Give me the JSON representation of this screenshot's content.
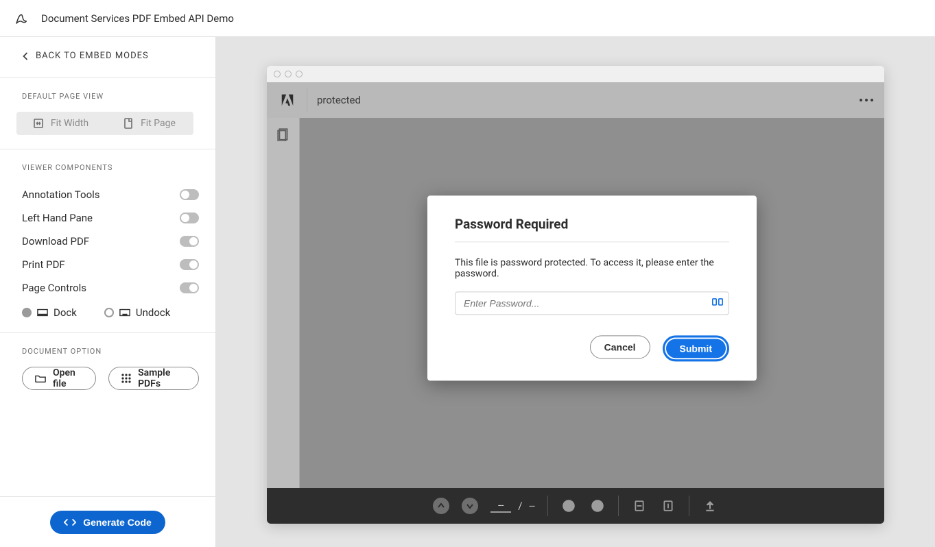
{
  "header": {
    "title": "Document Services PDF Embed API Demo"
  },
  "sidebar": {
    "back_label": "BACK TO EMBED MODES",
    "section_page_view": {
      "title": "DEFAULT PAGE VIEW",
      "fit_width": "Fit Width",
      "fit_page": "Fit Page"
    },
    "section_viewer": {
      "title": "VIEWER COMPONENTS",
      "items": [
        {
          "label": "Annotation Tools",
          "on": false
        },
        {
          "label": "Left Hand Pane",
          "on": false
        },
        {
          "label": "Download PDF",
          "on": true
        },
        {
          "label": "Print PDF",
          "on": true
        },
        {
          "label": "Page Controls",
          "on": true
        }
      ],
      "dock": "Dock",
      "undock": "Undock"
    },
    "section_doc": {
      "title": "DOCUMENT OPTION",
      "open_file": "Open file",
      "sample_pdfs": "Sample PDFs"
    },
    "generate": "Generate Code"
  },
  "viewer": {
    "doc_name": "protected",
    "modal": {
      "title": "Password Required",
      "message": "This file is password protected. To access it, please enter the password.",
      "placeholder": "Enter Password...",
      "cancel": "Cancel",
      "submit": "Submit"
    },
    "page_controls": {
      "current": "--",
      "sep": "/",
      "total": "--"
    }
  }
}
